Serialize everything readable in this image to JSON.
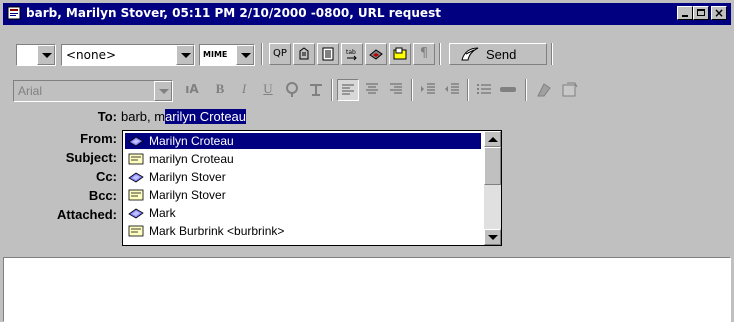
{
  "window": {
    "title": "barb, Marilyn Stover, 05:11 PM 2/10/2000 -0800, URL request",
    "min_label": "_",
    "max_label": "□",
    "close_label": "×"
  },
  "toolbar1": {
    "signature_combo": "",
    "stationery_combo": "<none>",
    "mime_combo": "MIME",
    "qp_label": "QP",
    "send_label": "Send"
  },
  "toolbar2": {
    "font_combo": "Arial",
    "bold_label": "B",
    "italic_label": "I",
    "underline_label": "U"
  },
  "headers": {
    "to_label": "To:",
    "from_label": "From:",
    "subject_label": "Subject:",
    "cc_label": "Cc:",
    "bcc_label": "Bcc:",
    "attached_label": "Attached:",
    "to_value_prefix": "barb, m",
    "to_value_selected": "arilyn Croteau"
  },
  "autocomplete": {
    "items": [
      {
        "label": "Marilyn Croteau",
        "icon": "nickname-icon",
        "selected": true
      },
      {
        "label": "marilyn Croteau",
        "icon": "card-icon",
        "selected": false
      },
      {
        "label": "Marilyn Stover",
        "icon": "nickname-icon",
        "selected": false
      },
      {
        "label": "Marilyn Stover",
        "icon": "card-icon",
        "selected": false
      },
      {
        "label": "Mark",
        "icon": "nickname-icon",
        "selected": false
      },
      {
        "label": "Mark Burbrink <burbrink>",
        "icon": "card-icon",
        "selected": false
      }
    ]
  },
  "colors": {
    "title_bar": "#000080",
    "selection": "#000080",
    "face": "#c0c0c0"
  }
}
